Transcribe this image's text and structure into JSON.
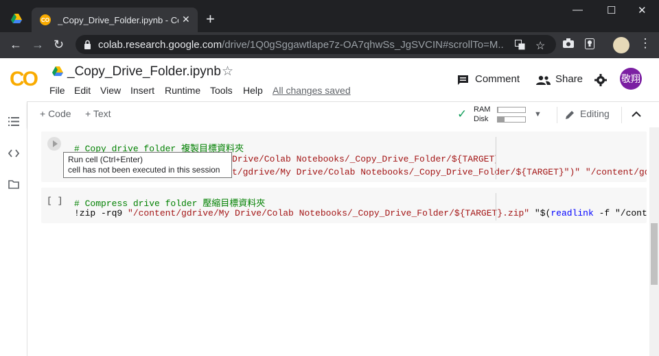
{
  "browser": {
    "tab_title": "_Copy_Drive_Folder.ipynb - Colab",
    "close_glyph": "✕",
    "new_tab_glyph": "+",
    "url_host": "colab.research.google.com",
    "url_path": "/drive/1Q0gSggawtlape7z-OA7qhwSs_JgSVCIN#scrollTo=M...",
    "back_glyph": "←",
    "forward_glyph": "→",
    "reload_glyph": "↻",
    "min_glyph": "—",
    "max_glyph": "☐",
    "win_close_glyph": "✕",
    "star_glyph": "☆",
    "menu_glyph": "⋮"
  },
  "header": {
    "logo": "CO",
    "notebook_title": "_Copy_Drive_Folder.ipynb",
    "menu": [
      "File",
      "Edit",
      "View",
      "Insert",
      "Runtime",
      "Tools",
      "Help"
    ],
    "saved_status": "All changes saved",
    "comment_label": "Comment",
    "share_label": "Share",
    "avatar_text": "敬翔"
  },
  "actionbar": {
    "add_code": "+ Code",
    "add_text": "+ Text",
    "ram_label": "RAM",
    "disk_label": "Disk",
    "ram_usage": 0.02,
    "disk_usage": 0.25,
    "editing_label": "Editing",
    "colors": {
      "accent": "#f9ab00",
      "check": "#0f9d58",
      "avatar": "#7b1fa2"
    }
  },
  "cells": [
    {
      "line1_comment": "# Copy drive folder 複製目標資料夾",
      "line2": "Drive/Colab Notebooks/_Copy_Drive_Folder/${TARGET}_copy\"",
      "line3": "t/gdrive/My Drive/Colab Notebooks/_Copy_Drive_Folder/${TARGET}\")\" \"/content/gd"
    },
    {
      "exec_count": "[ ]",
      "line1_comment": "# Compress drive folder 壓縮目標資料夾",
      "line2_cmd": "!zip -rq9 ",
      "line2_str": "\"/content/gdrive/My Drive/Colab Notebooks/_Copy_Drive_Folder/${TARGET}.zip\"",
      "line2_tail_a": " \"$(",
      "line2_kw": "readlink",
      "line2_tail_b": " -f \"/conte"
    }
  ],
  "tooltip": {
    "line1": "Run cell (Ctrl+Enter)",
    "line2": "cell has not been executed in this session"
  }
}
